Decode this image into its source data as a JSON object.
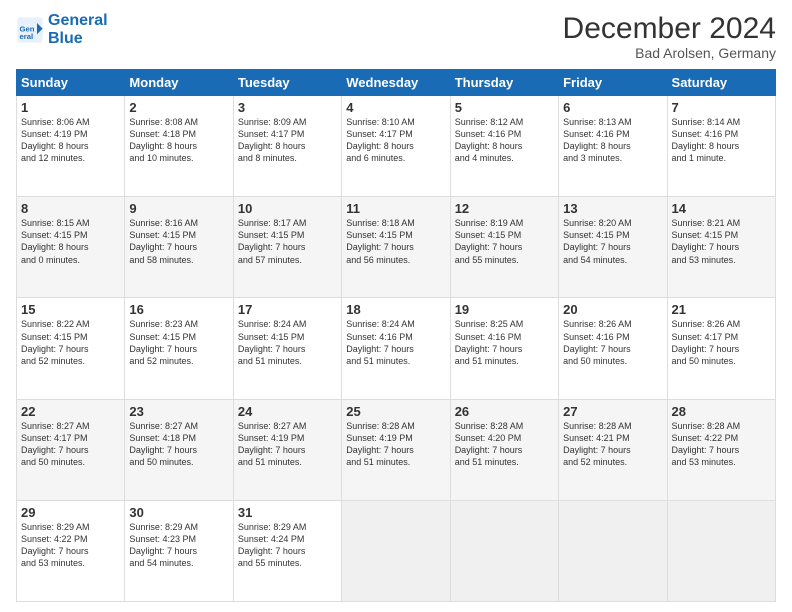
{
  "header": {
    "logo_line1": "General",
    "logo_line2": "Blue",
    "month_title": "December 2024",
    "location": "Bad Arolsen, Germany"
  },
  "weekdays": [
    "Sunday",
    "Monday",
    "Tuesday",
    "Wednesday",
    "Thursday",
    "Friday",
    "Saturday"
  ],
  "weeks": [
    [
      {
        "day": "1",
        "lines": [
          "Sunrise: 8:06 AM",
          "Sunset: 4:19 PM",
          "Daylight: 8 hours",
          "and 12 minutes."
        ]
      },
      {
        "day": "2",
        "lines": [
          "Sunrise: 8:08 AM",
          "Sunset: 4:18 PM",
          "Daylight: 8 hours",
          "and 10 minutes."
        ]
      },
      {
        "day": "3",
        "lines": [
          "Sunrise: 8:09 AM",
          "Sunset: 4:17 PM",
          "Daylight: 8 hours",
          "and 8 minutes."
        ]
      },
      {
        "day": "4",
        "lines": [
          "Sunrise: 8:10 AM",
          "Sunset: 4:17 PM",
          "Daylight: 8 hours",
          "and 6 minutes."
        ]
      },
      {
        "day": "5",
        "lines": [
          "Sunrise: 8:12 AM",
          "Sunset: 4:16 PM",
          "Daylight: 8 hours",
          "and 4 minutes."
        ]
      },
      {
        "day": "6",
        "lines": [
          "Sunrise: 8:13 AM",
          "Sunset: 4:16 PM",
          "Daylight: 8 hours",
          "and 3 minutes."
        ]
      },
      {
        "day": "7",
        "lines": [
          "Sunrise: 8:14 AM",
          "Sunset: 4:16 PM",
          "Daylight: 8 hours",
          "and 1 minute."
        ]
      }
    ],
    [
      {
        "day": "8",
        "lines": [
          "Sunrise: 8:15 AM",
          "Sunset: 4:15 PM",
          "Daylight: 8 hours",
          "and 0 minutes."
        ]
      },
      {
        "day": "9",
        "lines": [
          "Sunrise: 8:16 AM",
          "Sunset: 4:15 PM",
          "Daylight: 7 hours",
          "and 58 minutes."
        ]
      },
      {
        "day": "10",
        "lines": [
          "Sunrise: 8:17 AM",
          "Sunset: 4:15 PM",
          "Daylight: 7 hours",
          "and 57 minutes."
        ]
      },
      {
        "day": "11",
        "lines": [
          "Sunrise: 8:18 AM",
          "Sunset: 4:15 PM",
          "Daylight: 7 hours",
          "and 56 minutes."
        ]
      },
      {
        "day": "12",
        "lines": [
          "Sunrise: 8:19 AM",
          "Sunset: 4:15 PM",
          "Daylight: 7 hours",
          "and 55 minutes."
        ]
      },
      {
        "day": "13",
        "lines": [
          "Sunrise: 8:20 AM",
          "Sunset: 4:15 PM",
          "Daylight: 7 hours",
          "and 54 minutes."
        ]
      },
      {
        "day": "14",
        "lines": [
          "Sunrise: 8:21 AM",
          "Sunset: 4:15 PM",
          "Daylight: 7 hours",
          "and 53 minutes."
        ]
      }
    ],
    [
      {
        "day": "15",
        "lines": [
          "Sunrise: 8:22 AM",
          "Sunset: 4:15 PM",
          "Daylight: 7 hours",
          "and 52 minutes."
        ]
      },
      {
        "day": "16",
        "lines": [
          "Sunrise: 8:23 AM",
          "Sunset: 4:15 PM",
          "Daylight: 7 hours",
          "and 52 minutes."
        ]
      },
      {
        "day": "17",
        "lines": [
          "Sunrise: 8:24 AM",
          "Sunset: 4:15 PM",
          "Daylight: 7 hours",
          "and 51 minutes."
        ]
      },
      {
        "day": "18",
        "lines": [
          "Sunrise: 8:24 AM",
          "Sunset: 4:16 PM",
          "Daylight: 7 hours",
          "and 51 minutes."
        ]
      },
      {
        "day": "19",
        "lines": [
          "Sunrise: 8:25 AM",
          "Sunset: 4:16 PM",
          "Daylight: 7 hours",
          "and 51 minutes."
        ]
      },
      {
        "day": "20",
        "lines": [
          "Sunrise: 8:26 AM",
          "Sunset: 4:16 PM",
          "Daylight: 7 hours",
          "and 50 minutes."
        ]
      },
      {
        "day": "21",
        "lines": [
          "Sunrise: 8:26 AM",
          "Sunset: 4:17 PM",
          "Daylight: 7 hours",
          "and 50 minutes."
        ]
      }
    ],
    [
      {
        "day": "22",
        "lines": [
          "Sunrise: 8:27 AM",
          "Sunset: 4:17 PM",
          "Daylight: 7 hours",
          "and 50 minutes."
        ]
      },
      {
        "day": "23",
        "lines": [
          "Sunrise: 8:27 AM",
          "Sunset: 4:18 PM",
          "Daylight: 7 hours",
          "and 50 minutes."
        ]
      },
      {
        "day": "24",
        "lines": [
          "Sunrise: 8:27 AM",
          "Sunset: 4:19 PM",
          "Daylight: 7 hours",
          "and 51 minutes."
        ]
      },
      {
        "day": "25",
        "lines": [
          "Sunrise: 8:28 AM",
          "Sunset: 4:19 PM",
          "Daylight: 7 hours",
          "and 51 minutes."
        ]
      },
      {
        "day": "26",
        "lines": [
          "Sunrise: 8:28 AM",
          "Sunset: 4:20 PM",
          "Daylight: 7 hours",
          "and 51 minutes."
        ]
      },
      {
        "day": "27",
        "lines": [
          "Sunrise: 8:28 AM",
          "Sunset: 4:21 PM",
          "Daylight: 7 hours",
          "and 52 minutes."
        ]
      },
      {
        "day": "28",
        "lines": [
          "Sunrise: 8:28 AM",
          "Sunset: 4:22 PM",
          "Daylight: 7 hours",
          "and 53 minutes."
        ]
      }
    ],
    [
      {
        "day": "29",
        "lines": [
          "Sunrise: 8:29 AM",
          "Sunset: 4:22 PM",
          "Daylight: 7 hours",
          "and 53 minutes."
        ]
      },
      {
        "day": "30",
        "lines": [
          "Sunrise: 8:29 AM",
          "Sunset: 4:23 PM",
          "Daylight: 7 hours",
          "and 54 minutes."
        ]
      },
      {
        "day": "31",
        "lines": [
          "Sunrise: 8:29 AM",
          "Sunset: 4:24 PM",
          "Daylight: 7 hours",
          "and 55 minutes."
        ]
      },
      null,
      null,
      null,
      null
    ]
  ]
}
